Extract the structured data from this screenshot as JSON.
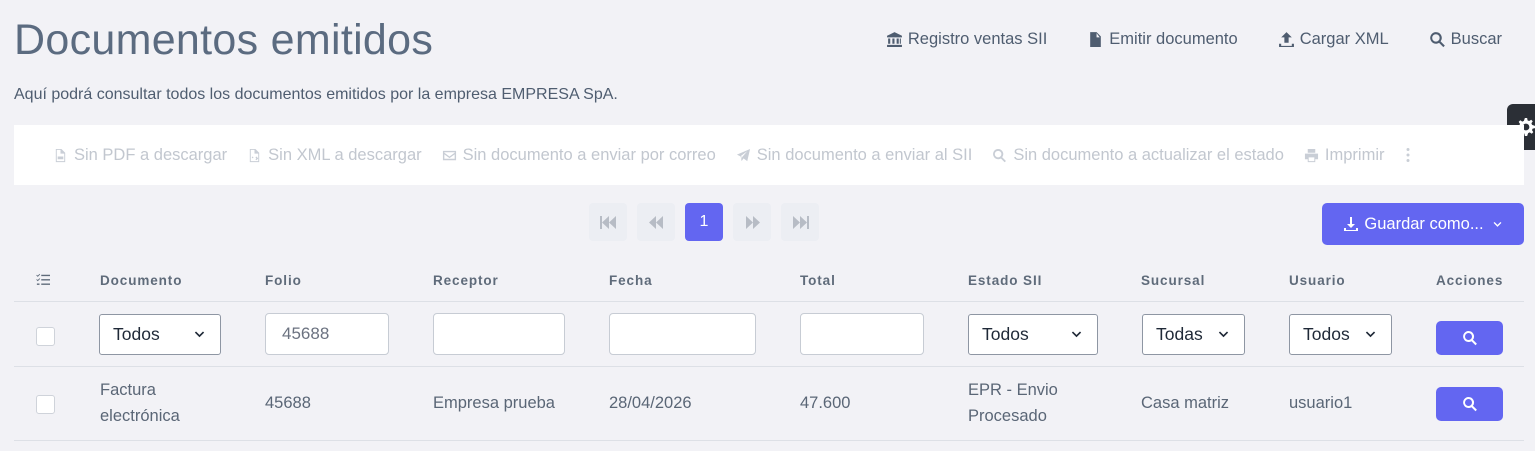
{
  "header": {
    "title": "Documentos emitidos",
    "subtitle": "Aquí podrá consultar todos los documentos emitidos por la empresa EMPRESA SpA.",
    "actions": [
      {
        "label": "Registro ventas SII",
        "icon": "bank-icon"
      },
      {
        "label": "Emitir documento",
        "icon": "file-icon"
      },
      {
        "label": "Cargar XML",
        "icon": "upload-icon"
      },
      {
        "label": "Buscar",
        "icon": "search-icon"
      }
    ]
  },
  "toolbar": {
    "items": [
      {
        "label": "Sin PDF a descargar",
        "icon": "pdf-file-icon"
      },
      {
        "label": "Sin XML a descargar",
        "icon": "xml-file-icon"
      },
      {
        "label": "Sin documento a enviar por correo",
        "icon": "envelope-icon"
      },
      {
        "label": "Sin documento a enviar al SII",
        "icon": "paper-plane-icon"
      },
      {
        "label": "Sin documento a actualizar el estado",
        "icon": "search-icon"
      },
      {
        "label": "Imprimir",
        "icon": "printer-icon"
      }
    ]
  },
  "pagination": {
    "current_page": "1"
  },
  "save_as": {
    "label": "Guardar como..."
  },
  "table": {
    "columns": [
      "Documento",
      "Folio",
      "Receptor",
      "Fecha",
      "Total",
      "Estado SII",
      "Sucursal",
      "Usuario",
      "Acciones"
    ],
    "filters": {
      "documento": "Todos",
      "folio": "45688",
      "receptor": "",
      "fecha": "",
      "total": "",
      "estado": "Todos",
      "sucursal": "Todas",
      "usuario": "Todos"
    },
    "rows": [
      {
        "documento": "Factura electrónica",
        "folio": "45688",
        "receptor": "Empresa prueba",
        "fecha": "28/04/2026",
        "total": "47.600",
        "estado": "EPR - Envio Procesado",
        "sucursal": "Casa matriz",
        "usuario": "usuario1"
      }
    ]
  },
  "colors": {
    "accent": "#6366f1",
    "background": "#f2f2f6"
  }
}
